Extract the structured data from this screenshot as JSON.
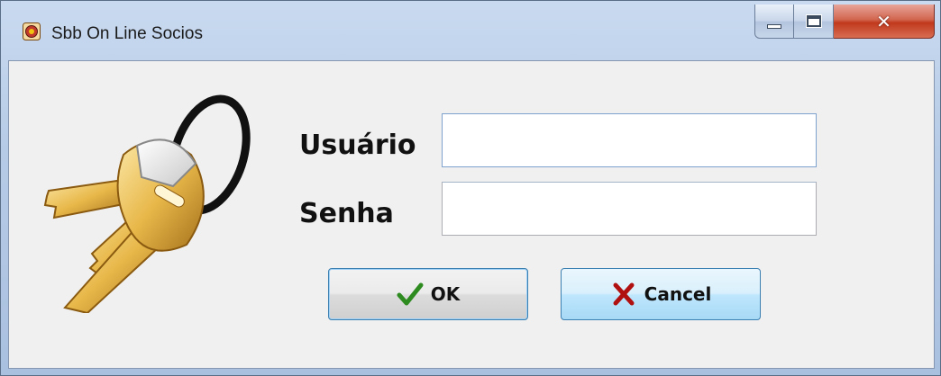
{
  "window": {
    "title": "Sbb On Line Socios",
    "controls": {
      "minimize": "minimize",
      "maximize": "maximize",
      "close": "close"
    }
  },
  "form": {
    "user_label": "Usuário",
    "user_value": "",
    "password_label": "Senha",
    "password_value": ""
  },
  "buttons": {
    "ok_label": "OK",
    "cancel_label": "Cancel"
  },
  "icons": {
    "app": "app-icon",
    "keys": "keys-icon",
    "ok": "checkmark-icon",
    "cancel": "x-icon"
  },
  "colors": {
    "checkmark": "#2e8b20",
    "cancel_x": "#b01010",
    "key_gold": "#e8b84a",
    "close_button": "#c1391d"
  }
}
